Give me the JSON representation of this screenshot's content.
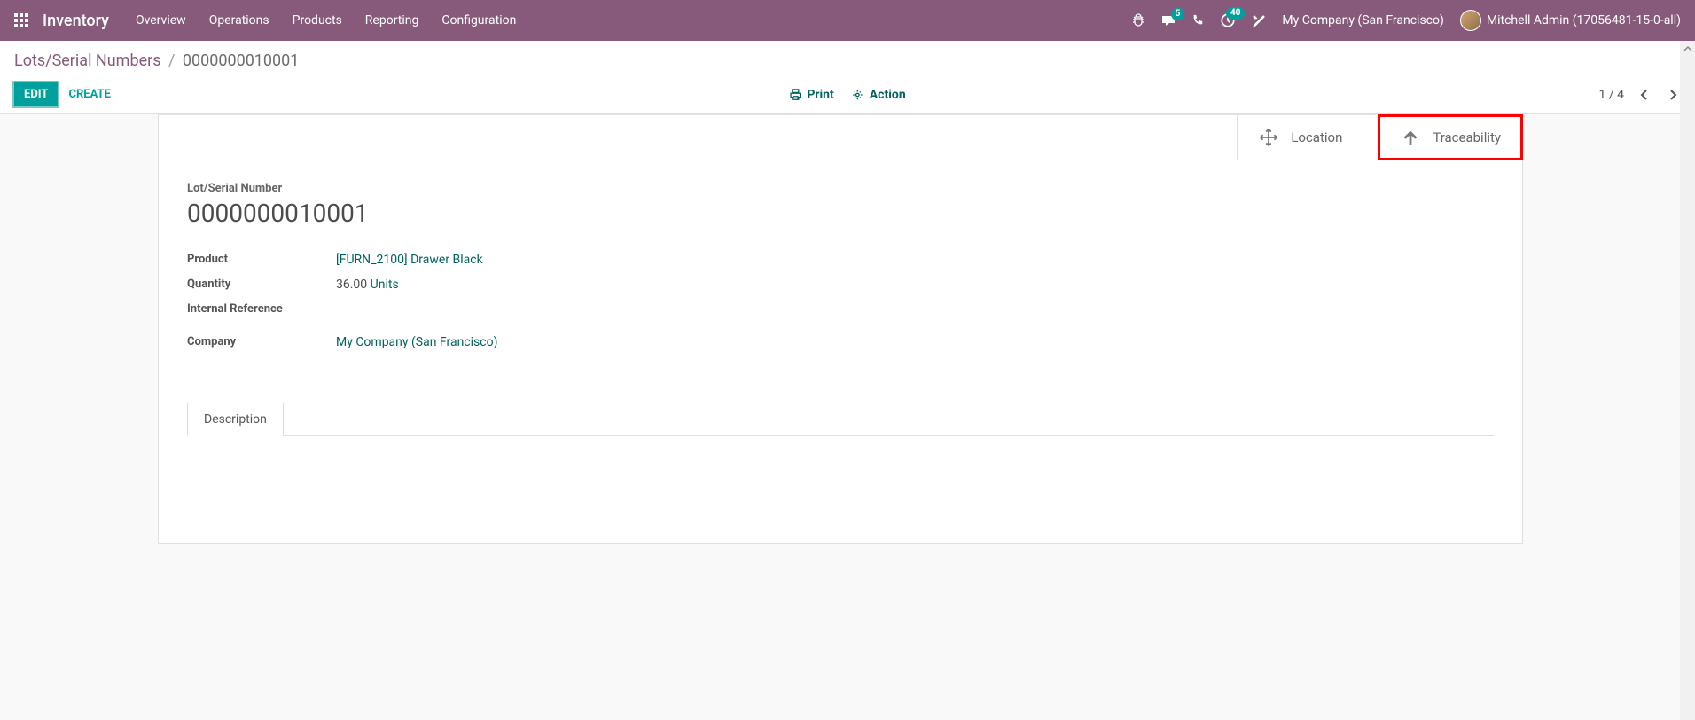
{
  "topbar": {
    "brand": "Inventory",
    "menu": [
      "Overview",
      "Operations",
      "Products",
      "Reporting",
      "Configuration"
    ],
    "messages_badge": "5",
    "activities_badge": "40",
    "company": "My Company (San Francisco)",
    "user": "Mitchell Admin (17056481-15-0-all)"
  },
  "breadcrumb": {
    "parent": "Lots/Serial Numbers",
    "current": "0000000010001"
  },
  "buttons": {
    "edit": "EDIT",
    "create": "CREATE",
    "print": "Print",
    "action": "Action"
  },
  "pager": {
    "text": "1 / 4"
  },
  "statboxes": {
    "location": "Location",
    "traceability": "Traceability"
  },
  "record": {
    "label_lot": "Lot/Serial Number",
    "lot_value": "0000000010001",
    "fields": {
      "product_label": "Product",
      "product_value": "[FURN_2100] Drawer Black",
      "quantity_label": "Quantity",
      "quantity_value": "36.00",
      "quantity_unit": "Units",
      "internal_ref_label": "Internal Reference",
      "company_label": "Company",
      "company_value": "My Company (San Francisco)"
    }
  },
  "tabs": {
    "description": "Description"
  }
}
